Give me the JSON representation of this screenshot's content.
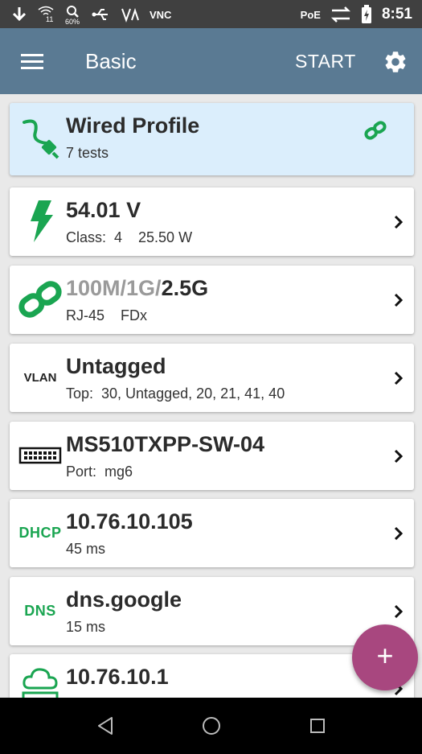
{
  "status_bar": {
    "icons": [
      "download-arrow-icon",
      "wifi-icon",
      "search-zoom-icon",
      "usb-icon",
      "voice-icon"
    ],
    "zoom_level": "60%",
    "wifi_label": "11",
    "vnc_label": "VNC",
    "poe_label": "PoE",
    "time": "8:51"
  },
  "app_bar": {
    "title": "Basic",
    "start_label": "START",
    "icons": [
      "menu-icon",
      "gear-icon"
    ],
    "background": "#5a7a93"
  },
  "cards": [
    {
      "id": "profile",
      "title": "Wired Profile",
      "subtitle": "7 tests",
      "icon": "ethernet-cable-icon"
    },
    {
      "id": "poe",
      "title": "54.01 V",
      "subtitle": "Class:  4    25.50 W",
      "icon": "lightning-icon"
    },
    {
      "id": "link",
      "title_muted": "100M/1G/",
      "title_bold": "2.5G",
      "subtitle": "RJ-45    FDx",
      "icon": "link-icon"
    },
    {
      "id": "vlan",
      "icon_text": "VLAN",
      "title": "Untagged",
      "subtitle": "Top:  30, Untagged, 20, 21, 41, 40"
    },
    {
      "id": "switch",
      "title": "MS510TXPP-SW-04",
      "subtitle": "Port:  mg6",
      "icon": "switch-icon"
    },
    {
      "id": "dhcp",
      "icon_text": "DHCP",
      "title": "10.76.10.105",
      "subtitle": "45 ms"
    },
    {
      "id": "dns",
      "icon_text": "DNS",
      "title": "dns.google",
      "subtitle": "15 ms"
    },
    {
      "id": "gateway",
      "title": "10.76.10.1",
      "subtitle": "",
      "icon": "cloud-gateway-icon"
    }
  ],
  "fab": {
    "label": "+",
    "color": "#a8477f"
  },
  "nav_bar": {
    "icons": [
      "back-icon",
      "home-icon",
      "recents-icon"
    ]
  },
  "colors": {
    "accent_green": "#1aa551",
    "profile_bg": "#dbeefc"
  }
}
